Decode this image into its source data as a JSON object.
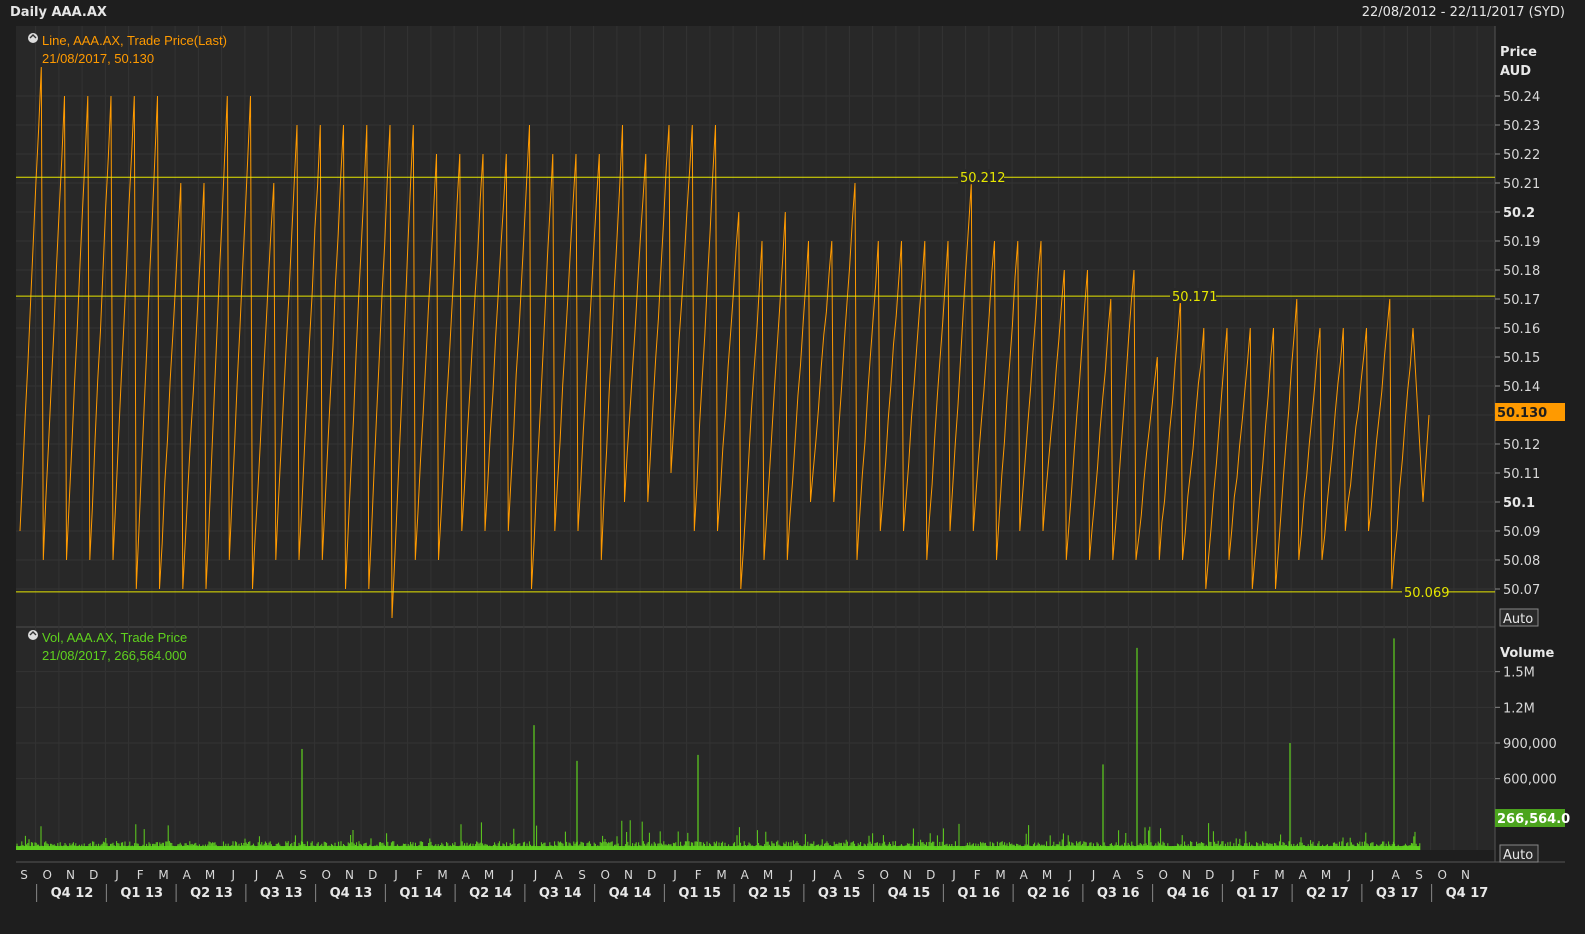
{
  "window": {
    "title": "Daily AAA.AX",
    "date_range": "22/08/2012 - 22/11/2017 (SYD)"
  },
  "price_panel": {
    "legend_line1": "Line, AAA.AX, Trade Price(Last)",
    "legend_line2": "21/08/2017, 50.130",
    "axis_title_1": "Price",
    "axis_title_2": "AUD",
    "current_value_label": "50.130",
    "auto_button": "Auto",
    "hlines": [
      {
        "value": 50.212,
        "label": "50.212"
      },
      {
        "value": 50.171,
        "label": "50.171"
      },
      {
        "value": 50.069,
        "label": "50.069"
      }
    ],
    "colors": {
      "line": "#ff9a00",
      "hline": "#e6e600",
      "badge": "#ff9a00"
    }
  },
  "volume_panel": {
    "legend_line1": "Vol, AAA.AX, Trade Price",
    "legend_line2": "21/08/2017, 266,564.000",
    "axis_title": "Volume",
    "current_value_label": "266,564.0",
    "auto_button": "Auto",
    "colors": {
      "bars": "#5fd21e",
      "badge": "#4ca41e"
    }
  },
  "chart_data": [
    {
      "type": "line",
      "title": "Line, AAA.AX, Trade Price(Last)",
      "ylabel": "Price AUD",
      "ylim": [
        50.064,
        50.25
      ],
      "y_ticks": [
        "50.24",
        "50.23",
        "50.22",
        "50.21",
        "50.2",
        "50.19",
        "50.18",
        "50.17",
        "50.16",
        "50.15",
        "50.14",
        "50.13",
        "50.12",
        "50.11",
        "50.1",
        "50.09",
        "50.08",
        "50.07"
      ],
      "y_ticks_bold": [
        "50.2",
        "50.1"
      ],
      "last_value": 50.13,
      "series_note": "sawtooth pattern: price climbs gradually then drops back each month",
      "monthly_cycles": [
        {
          "month": "S",
          "low": 50.09,
          "high": 50.25
        },
        {
          "month": "O",
          "low": 50.08,
          "high": 50.24
        },
        {
          "month": "N",
          "low": 50.08,
          "high": 50.24
        },
        {
          "month": "D",
          "low": 50.08,
          "high": 50.24
        },
        {
          "month": "J",
          "low": 50.08,
          "high": 50.24
        },
        {
          "month": "F",
          "low": 50.07,
          "high": 50.24
        },
        {
          "month": "M",
          "low": 50.07,
          "high": 50.21
        },
        {
          "month": "A",
          "low": 50.07,
          "high": 50.21
        },
        {
          "month": "M",
          "low": 50.07,
          "high": 50.24
        },
        {
          "month": "J",
          "low": 50.08,
          "high": 50.24
        },
        {
          "month": "J",
          "low": 50.07,
          "high": 50.21
        },
        {
          "month": "A",
          "low": 50.08,
          "high": 50.23
        },
        {
          "month": "S",
          "low": 50.08,
          "high": 50.23
        },
        {
          "month": "O",
          "low": 50.08,
          "high": 50.23
        },
        {
          "month": "N",
          "low": 50.07,
          "high": 50.23
        },
        {
          "month": "D",
          "low": 50.07,
          "high": 50.23
        },
        {
          "month": "J",
          "low": 50.06,
          "high": 50.23
        },
        {
          "month": "F",
          "low": 50.08,
          "high": 50.22
        },
        {
          "month": "M",
          "low": 50.08,
          "high": 50.22
        },
        {
          "month": "A",
          "low": 50.09,
          "high": 50.22
        },
        {
          "month": "M",
          "low": 50.09,
          "high": 50.22
        },
        {
          "month": "J",
          "low": 50.09,
          "high": 50.23
        },
        {
          "month": "J",
          "low": 50.07,
          "high": 50.22
        },
        {
          "month": "A",
          "low": 50.09,
          "high": 50.22
        },
        {
          "month": "S",
          "low": 50.09,
          "high": 50.22
        },
        {
          "month": "O",
          "low": 50.08,
          "high": 50.23
        },
        {
          "month": "N",
          "low": 50.1,
          "high": 50.22
        },
        {
          "month": "D",
          "low": 50.1,
          "high": 50.23
        },
        {
          "month": "J",
          "low": 50.11,
          "high": 50.23
        },
        {
          "month": "F",
          "low": 50.09,
          "high": 50.23
        },
        {
          "month": "M",
          "low": 50.09,
          "high": 50.2
        },
        {
          "month": "A",
          "low": 50.07,
          "high": 50.19
        },
        {
          "month": "M",
          "low": 50.08,
          "high": 50.2
        },
        {
          "month": "J",
          "low": 50.08,
          "high": 50.19
        },
        {
          "month": "J",
          "low": 50.1,
          "high": 50.19
        },
        {
          "month": "A",
          "low": 50.1,
          "high": 50.21
        },
        {
          "month": "S",
          "low": 50.08,
          "high": 50.19
        },
        {
          "month": "O",
          "low": 50.09,
          "high": 50.19
        },
        {
          "month": "N",
          "low": 50.09,
          "high": 50.19
        },
        {
          "month": "D",
          "low": 50.08,
          "high": 50.19
        },
        {
          "month": "J",
          "low": 50.09,
          "high": 50.21
        },
        {
          "month": "F",
          "low": 50.09,
          "high": 50.19
        },
        {
          "month": "M",
          "low": 50.08,
          "high": 50.19
        },
        {
          "month": "A",
          "low": 50.09,
          "high": 50.19
        },
        {
          "month": "M",
          "low": 50.09,
          "high": 50.18
        },
        {
          "month": "J",
          "low": 50.08,
          "high": 50.18
        },
        {
          "month": "J",
          "low": 50.08,
          "high": 50.17
        },
        {
          "month": "A",
          "low": 50.08,
          "high": 50.18
        },
        {
          "month": "S",
          "low": 50.08,
          "high": 50.15
        },
        {
          "month": "O",
          "low": 50.08,
          "high": 50.17
        },
        {
          "month": "N",
          "low": 50.08,
          "high": 50.16
        },
        {
          "month": "D",
          "low": 50.07,
          "high": 50.16
        },
        {
          "month": "J",
          "low": 50.08,
          "high": 50.16
        },
        {
          "month": "F",
          "low": 50.07,
          "high": 50.16
        },
        {
          "month": "M",
          "low": 50.07,
          "high": 50.17
        },
        {
          "month": "A",
          "low": 50.08,
          "high": 50.16
        },
        {
          "month": "M",
          "low": 50.08,
          "high": 50.16
        },
        {
          "month": "J",
          "low": 50.09,
          "high": 50.16
        },
        {
          "month": "J",
          "low": 50.09,
          "high": 50.17
        },
        {
          "month": "A",
          "low": 50.07,
          "high": 50.16
        }
      ],
      "horizontal_lines": [
        50.212,
        50.171,
        50.069
      ]
    },
    {
      "type": "bar",
      "title": "Vol, AAA.AX, Trade Price",
      "ylabel": "Volume",
      "ylim": [
        0,
        1750000
      ],
      "y_ticks": [
        "1.5M",
        "1.2M",
        "900,000",
        "600,000"
      ],
      "last_value": 266564,
      "notable_spikes": [
        {
          "x": "Jul 2013",
          "value": 850000
        },
        {
          "x": "Jul 2014",
          "value": 1050000
        },
        {
          "x": "Aug 2014",
          "value": 750000
        },
        {
          "x": "Jan 2015",
          "value": 800000
        },
        {
          "x": "Jul 2016",
          "value": 720000
        },
        {
          "x": "Aug 2016",
          "value": 1700000
        },
        {
          "x": "Mar 2017",
          "value": 900000
        },
        {
          "x": "Jul 2017",
          "value": 1780000
        }
      ]
    }
  ],
  "x_axis": {
    "months": [
      "S",
      "O",
      "N",
      "D",
      "J",
      "F",
      "M",
      "A",
      "M",
      "J",
      "J",
      "A",
      "S",
      "O",
      "N",
      "D",
      "J",
      "F",
      "M",
      "A",
      "M",
      "J",
      "J",
      "A",
      "S",
      "O",
      "N",
      "D",
      "J",
      "F",
      "M",
      "A",
      "M",
      "J",
      "J",
      "A",
      "S",
      "O",
      "N",
      "D",
      "J",
      "F",
      "M",
      "A",
      "M",
      "J",
      "J",
      "A",
      "S",
      "O",
      "N",
      "D",
      "J",
      "F",
      "M",
      "A",
      "M",
      "J",
      "J",
      "A",
      "S",
      "O",
      "N"
    ],
    "quarters": [
      "Q4 12",
      "Q1 13",
      "Q2 13",
      "Q3 13",
      "Q4 13",
      "Q1 14",
      "Q2 14",
      "Q3 14",
      "Q4 14",
      "Q1 15",
      "Q2 15",
      "Q3 15",
      "Q4 15",
      "Q1 16",
      "Q2 16",
      "Q3 16",
      "Q4 16",
      "Q1 17",
      "Q2 17",
      "Q3 17",
      "Q4 17"
    ]
  }
}
